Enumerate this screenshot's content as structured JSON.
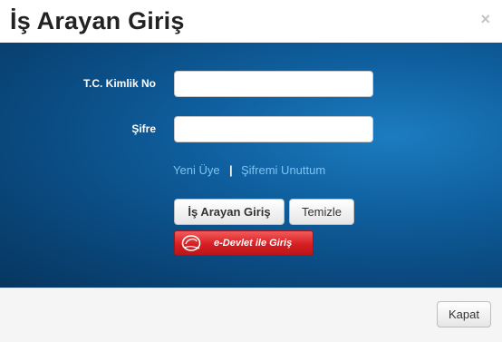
{
  "dialog": {
    "title": "İş Arayan Giriş",
    "close_glyph": "×"
  },
  "form": {
    "tc_label": "T.C. Kimlik No",
    "tc_value": "",
    "password_label": "Şifre",
    "password_value": ""
  },
  "links": {
    "new_member": "Yeni Üye",
    "separator": "|",
    "forgot_password": "Şifremi Unuttum"
  },
  "buttons": {
    "login": "İş Arayan Giriş",
    "clear": "Temizle",
    "edevlet": "e-Devlet ile Giriş"
  },
  "footer": {
    "close": "Kapat"
  },
  "colors": {
    "body_blue": "#0f5f9e",
    "link": "#7ec3ee",
    "edevlet_red": "#d61f22"
  },
  "icons": {
    "close": "close-icon",
    "edevlet_logo": "edevlet-logo-icon"
  }
}
